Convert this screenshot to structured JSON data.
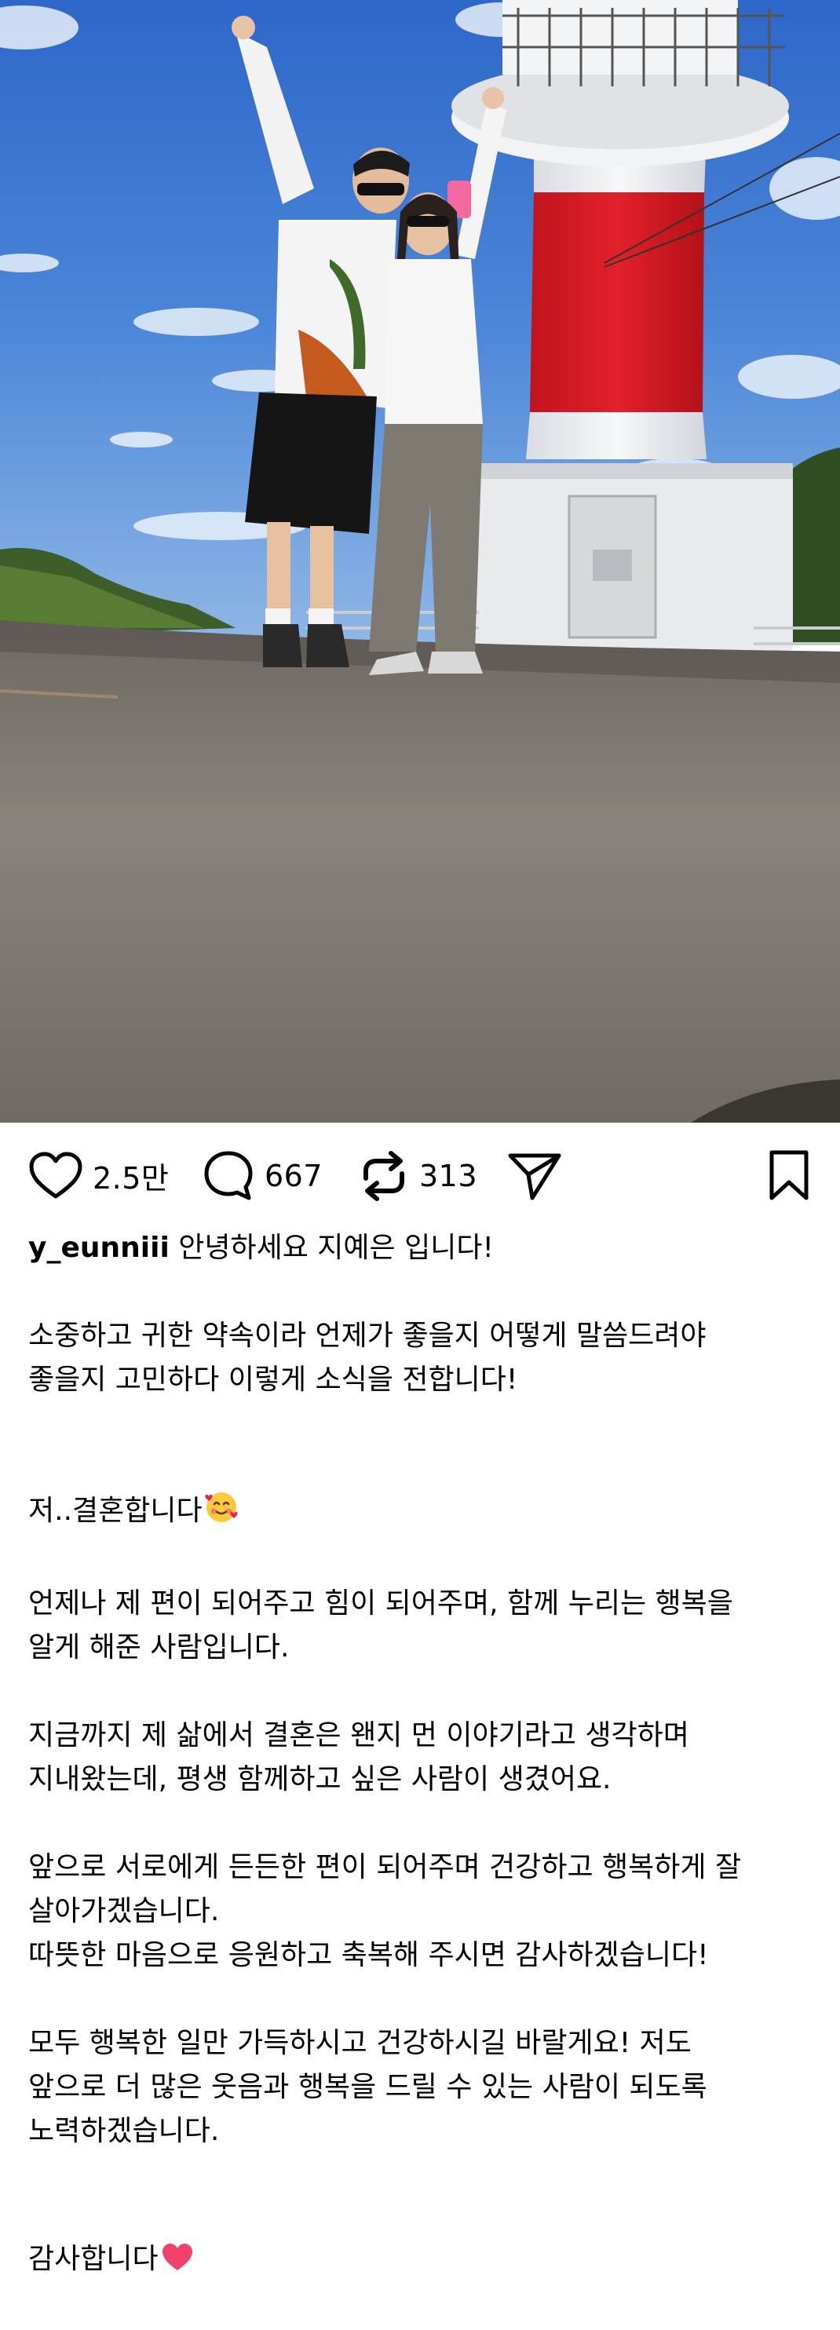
{
  "post": {
    "image_alt": "Couple posing in front of a red and white lighthouse",
    "actions": {
      "likes": "2.5만",
      "comments": "667",
      "reposts": "313"
    },
    "username": "y_eunniii",
    "caption": {
      "p1": "안녕하세요 지예은 입니다!",
      "p2": "소중하고 귀한 약속이라 언제가 좋을지 어떻게 말씀드려야\n좋을지 고민하다 이렇게 소식을 전합니다!",
      "p3": "저..결혼합니다",
      "p4": "언제나 제 편이 되어주고 힘이 되어주며, 함께 누리는 행복을\n알게 해준 사람입니다.",
      "p5": "지금까지 제 삶에서 결혼은 왠지 먼 이야기라고 생각하며\n지내왔는데, 평생 함께하고 싶은 사람이 생겼어요.",
      "p6": "앞으로 서로에게 든든한 편이 되어주며 건강하고 행복하게 잘\n살아가겠습니다.\n따뜻한 마음으로 응원하고 축복해 주시면 감사하겠습니다!",
      "p7": "모두 행복한 일만 가득하시고 건강하시길 바랄게요! 저도\n앞으로 더 많은 웃음과 행복을 드릴 수 있는 사람이 되도록\n노력하겠습니다.",
      "p8": "감사합니다"
    },
    "emojis": {
      "p3": "smiling-face-with-hearts-emoji",
      "p8": "red-heart-emoji"
    }
  },
  "icons": {
    "like": "heart-icon",
    "comment": "comment-bubble-icon",
    "repost": "repost-icon",
    "share": "send-icon",
    "bookmark": "bookmark-icon"
  }
}
